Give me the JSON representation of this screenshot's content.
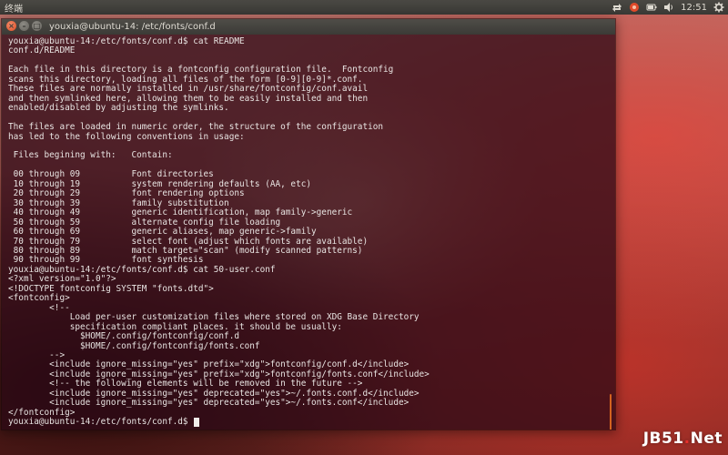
{
  "panel": {
    "title": "终端",
    "clock": "12:51",
    "icons": [
      "transfer-arrows-icon",
      "network-icon",
      "battery-icon",
      "volume-icon",
      "session-gear-icon"
    ]
  },
  "terminal": {
    "title": "youxia@ubuntu-14: /etc/fonts/conf.d",
    "lines": [
      "youxia@ubuntu-14:/etc/fonts/conf.d$ cat README",
      "conf.d/README",
      "",
      "Each file in this directory is a fontconfig configuration file.  Fontconfig",
      "scans this directory, loading all files of the form [0-9][0-9]*.conf.",
      "These files are normally installed in /usr/share/fontconfig/conf.avail",
      "and then symlinked here, allowing them to be easily installed and then",
      "enabled/disabled by adjusting the symlinks.",
      "",
      "The files are loaded in numeric order, the structure of the configuration",
      "has led to the following conventions in usage:",
      "",
      " Files begining with:   Contain:",
      "",
      " 00 through 09          Font directories",
      " 10 through 19          system rendering defaults (AA, etc)",
      " 20 through 29          font rendering options",
      " 30 through 39          family substitution",
      " 40 through 49          generic identification, map family->generic",
      " 50 through 59          alternate config file loading",
      " 60 through 69          generic aliases, map generic->family",
      " 70 through 79          select font (adjust which fonts are available)",
      " 80 through 89          match target=\"scan\" (modify scanned patterns)",
      " 90 through 99          font synthesis",
      "youxia@ubuntu-14:/etc/fonts/conf.d$ cat 50-user.conf",
      "<?xml version=\"1.0\"?>",
      "<!DOCTYPE fontconfig SYSTEM \"fonts.dtd\">",
      "<fontconfig>",
      "        <!--",
      "            Load per-user customization files where stored on XDG Base Directory",
      "            specification compliant places. it should be usually:",
      "              $HOME/.config/fontconfig/conf.d",
      "              $HOME/.config/fontconfig/fonts.conf",
      "        -->",
      "        <include ignore_missing=\"yes\" prefix=\"xdg\">fontconfig/conf.d</include>",
      "        <include ignore_missing=\"yes\" prefix=\"xdg\">fontconfig/fonts.conf</include>",
      "        <!-- the following elements will be removed in the future -->",
      "        <include ignore_missing=\"yes\" deprecated=\"yes\">~/.fonts.conf.d</include>",
      "        <include ignore_missing=\"yes\" deprecated=\"yes\">~/.fonts.conf</include>",
      "</fontconfig>"
    ],
    "prompt": "youxia@ubuntu-14:/etc/fonts/conf.d$ "
  },
  "watermark": {
    "prefix": "JB51",
    "dot": ".",
    "suffix": "Net"
  },
  "colors": {
    "terminal_bg": "#2a0816",
    "panel_bg": "#3c3b37",
    "close_button": "#e25f38",
    "scroll_thumb": "#d3631f",
    "watermark_accent": "#e8312c"
  }
}
